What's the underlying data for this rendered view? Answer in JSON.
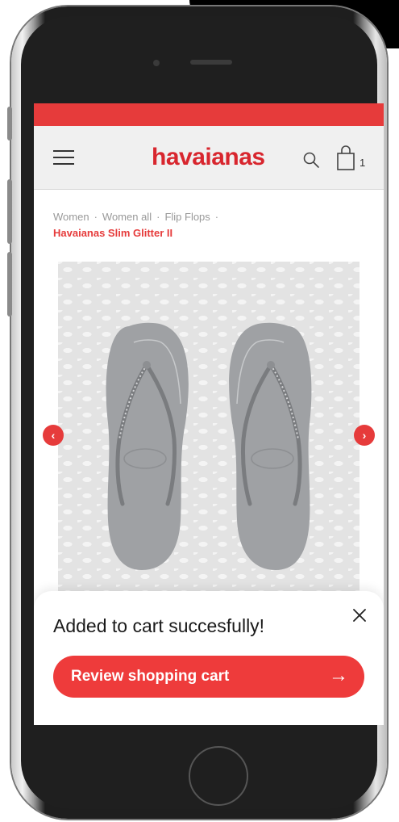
{
  "header": {
    "brand": "havaianas",
    "cart_count": "1"
  },
  "breadcrumb": {
    "items": [
      "Women",
      "Women all",
      "Flip Flops"
    ],
    "separator": "·",
    "current": "Havaianas Slim Glitter II"
  },
  "gallery": {
    "prev_icon": "chevron-left-icon",
    "next_icon": "chevron-right-icon"
  },
  "toast": {
    "message": "Added to cart succesfully!",
    "button_label": "Review shopping cart",
    "button_arrow": "→"
  },
  "colors": {
    "accent": "#e63b3b",
    "logo": "#d8262e",
    "header_bg": "#f0f0f0",
    "product": "#9fa1a4"
  }
}
